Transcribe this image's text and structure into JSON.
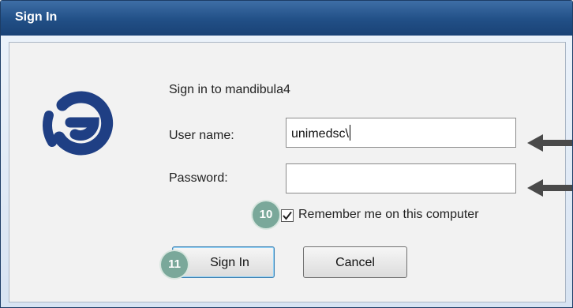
{
  "window": {
    "title": "Sign In"
  },
  "dialog": {
    "prompt": "Sign in to mandibula4",
    "username_label": "User name:",
    "username_value": "unimedsc\\",
    "password_label": "Password:",
    "password_value": "",
    "remember_label": "Remember me on this computer",
    "remember_checked": true,
    "signin_label": "Sign In",
    "cancel_label": "Cancel"
  },
  "annotations": {
    "step_remember": "10",
    "step_signin": "11",
    "arrow_color": "#4a4a4a",
    "badge_color": "#7aa89a"
  },
  "logo": {
    "icon": "g-logo-icon",
    "color": "#1f3f84"
  }
}
